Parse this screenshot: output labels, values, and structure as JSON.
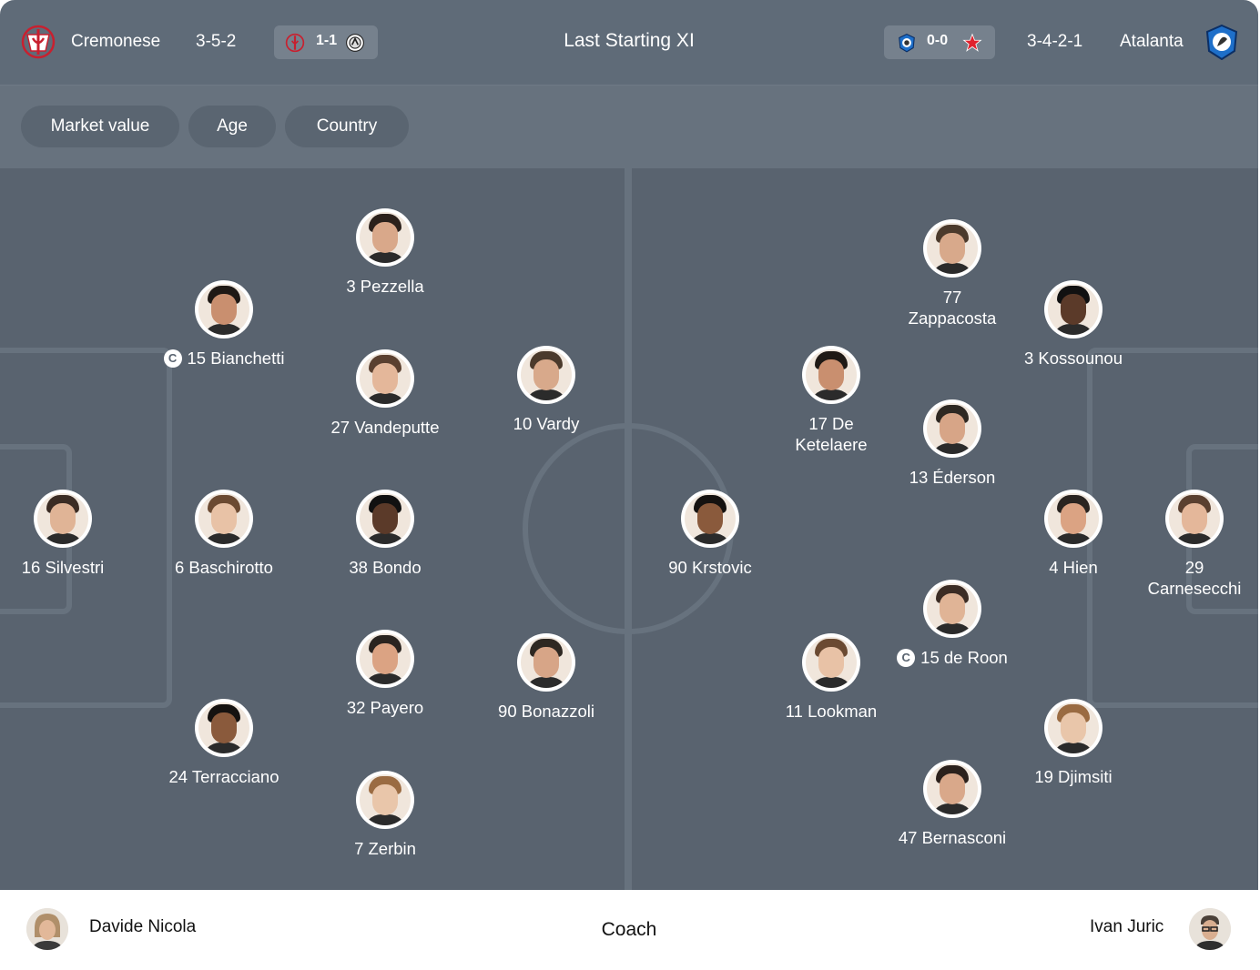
{
  "header": {
    "title": "Last Starting XI",
    "home": {
      "name": "Cremonese",
      "formation": "3-5-2",
      "last_score": "1-1",
      "logo_icon": "cremonese-crest-icon",
      "opponent_icon": "udinese-crest-icon"
    },
    "away": {
      "name": "Atalanta",
      "formation": "3-4-2-1",
      "last_score": "0-0",
      "logo_icon": "atalanta-crest-icon",
      "opponent_icon": "red-star-crest-icon"
    }
  },
  "filters": [
    "Market value",
    "Age",
    "Country"
  ],
  "captain_badge": "C",
  "home_players": [
    {
      "label": "16 Silvestri",
      "captain": false
    },
    {
      "label": "3 Pezzella",
      "captain": false
    },
    {
      "label": "15 Bianchetti",
      "captain": true
    },
    {
      "label": "6 Baschirotto",
      "captain": false
    },
    {
      "label": "24 Terracciano",
      "captain": false
    },
    {
      "label": "27 Vandeputte",
      "captain": false
    },
    {
      "label": "38 Bondo",
      "captain": false
    },
    {
      "label": "32 Payero",
      "captain": false
    },
    {
      "label": "7 Zerbin",
      "captain": false
    },
    {
      "label": "10 Vardy",
      "captain": false
    },
    {
      "label": "90 Bonazzoli",
      "captain": false
    }
  ],
  "away_players": [
    {
      "label": "29\nCarnesecchi",
      "captain": false
    },
    {
      "label": "3 Kossounou",
      "captain": false
    },
    {
      "label": "4 Hien",
      "captain": false
    },
    {
      "label": "19 Djimsiti",
      "captain": false
    },
    {
      "label": "77\nZappacosta",
      "captain": false
    },
    {
      "label": "13 Éderson",
      "captain": false
    },
    {
      "label": "15 de Roon",
      "captain": true
    },
    {
      "label": "47 Bernasconi",
      "captain": false
    },
    {
      "label": "17 De\nKetelaere",
      "captain": false
    },
    {
      "label": "11 Lookman",
      "captain": false
    },
    {
      "label": "90 Krstovic",
      "captain": false
    }
  ],
  "coach": {
    "title": "Coach",
    "home_name": "Davide Nicola",
    "away_name": "Ivan Juric"
  },
  "colors": {
    "header_bg": "#5f6b78",
    "filter_bar_bg": "#67727e",
    "pitch_bg": "#59636f",
    "pitch_lines": "#67727e"
  }
}
